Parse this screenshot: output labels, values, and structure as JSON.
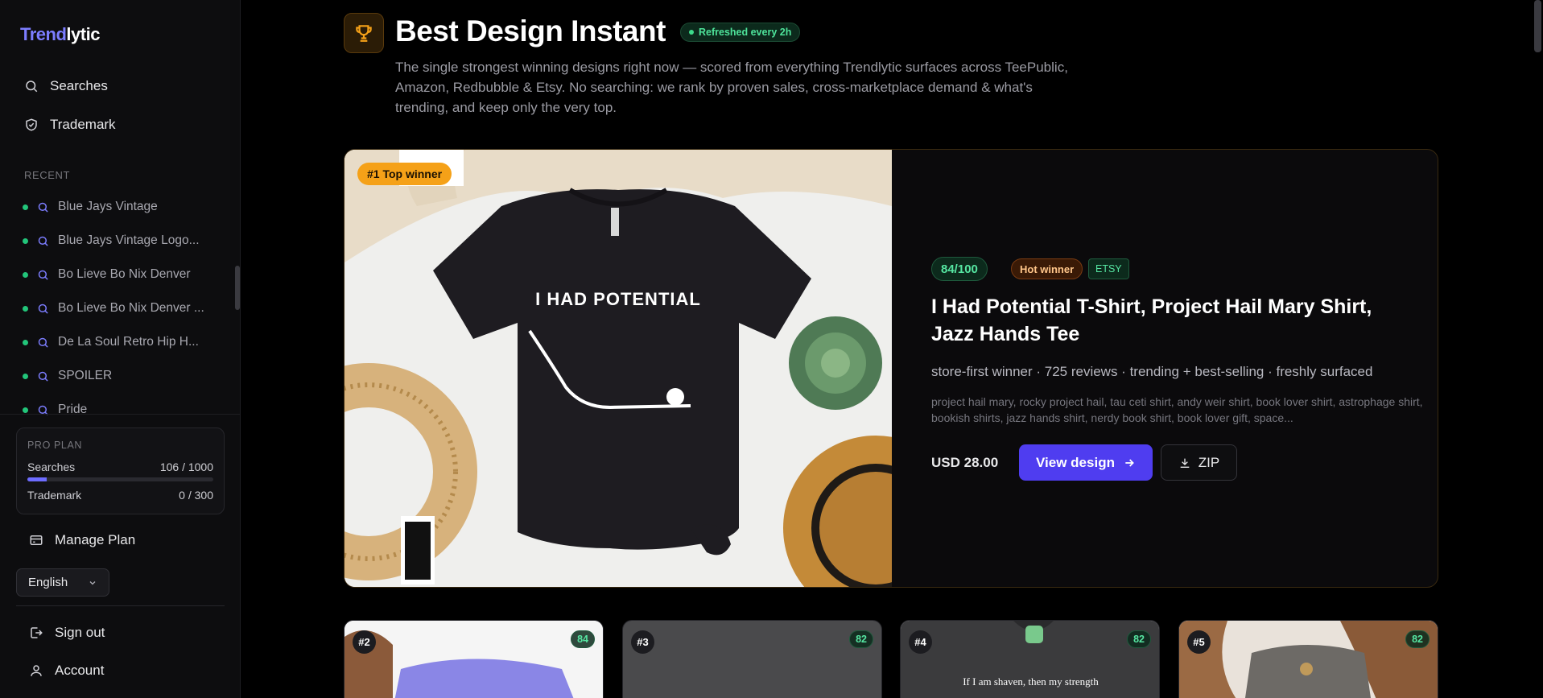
{
  "brand": {
    "part1": "Trend",
    "part2": "lytic"
  },
  "nav": {
    "searches": "Searches",
    "trademark": "Trademark"
  },
  "recent": {
    "heading": "RECENT",
    "items": [
      "Blue Jays Vintage",
      "Blue Jays Vintage Logo...",
      "Bo Lieve Bo Nix Denver",
      "Bo Lieve Bo Nix Denver ...",
      "De La Soul Retro Hip H...",
      "SPOILER",
      "Pride"
    ]
  },
  "plan": {
    "title": "PRO PLAN",
    "searches_label": "Searches",
    "searches_value": "106 / 1000",
    "searches_fraction": 0.106,
    "trademark_label": "Trademark",
    "trademark_value": "0 / 300"
  },
  "manage_plan": "Manage Plan",
  "language": "English",
  "sign_out": "Sign out",
  "account": "Account",
  "page": {
    "title": "Best Design Instant",
    "refresh_badge": "Refreshed every 2h",
    "subtitle": "The single strongest winning designs right now — scored from everything Trendlytic surfaces across TeePublic, Amazon, Redbubble & Etsy. No searching: we rank by proven sales, cross-marketplace demand & what's trending, and keep only the very top."
  },
  "hero": {
    "badge": "#1 Top winner",
    "shirt_text": "I HAD POTENTIAL",
    "score": "84/100",
    "hot": "Hot winner",
    "market": "ETSY",
    "title": "I Had Potential T-Shirt, Project Hail Mary Shirt, Jazz Hands Tee",
    "meta": "store-first winner · 725 reviews · trending + best-selling · freshly surfaced",
    "tags": "project hail mary, rocky project hail, tau ceti shirt, andy weir shirt, book lover shirt, astrophage shirt, bookish shirts, jazz hands shirt, nerdy book shirt, book lover gift, space...",
    "price": "USD 28.00",
    "view_label": "View design",
    "zip_label": "ZIP"
  },
  "cards": [
    {
      "rank": "#2",
      "score": "84"
    },
    {
      "rank": "#3",
      "score": "82"
    },
    {
      "rank": "#4",
      "score": "82",
      "shirt_text": "If I am shaven, then my strength"
    },
    {
      "rank": "#5",
      "score": "82"
    }
  ],
  "colors": {
    "accent": "#4f3df0",
    "brand": "#7c7dff",
    "success": "#3ddc8b",
    "gold": "#f5a118"
  }
}
